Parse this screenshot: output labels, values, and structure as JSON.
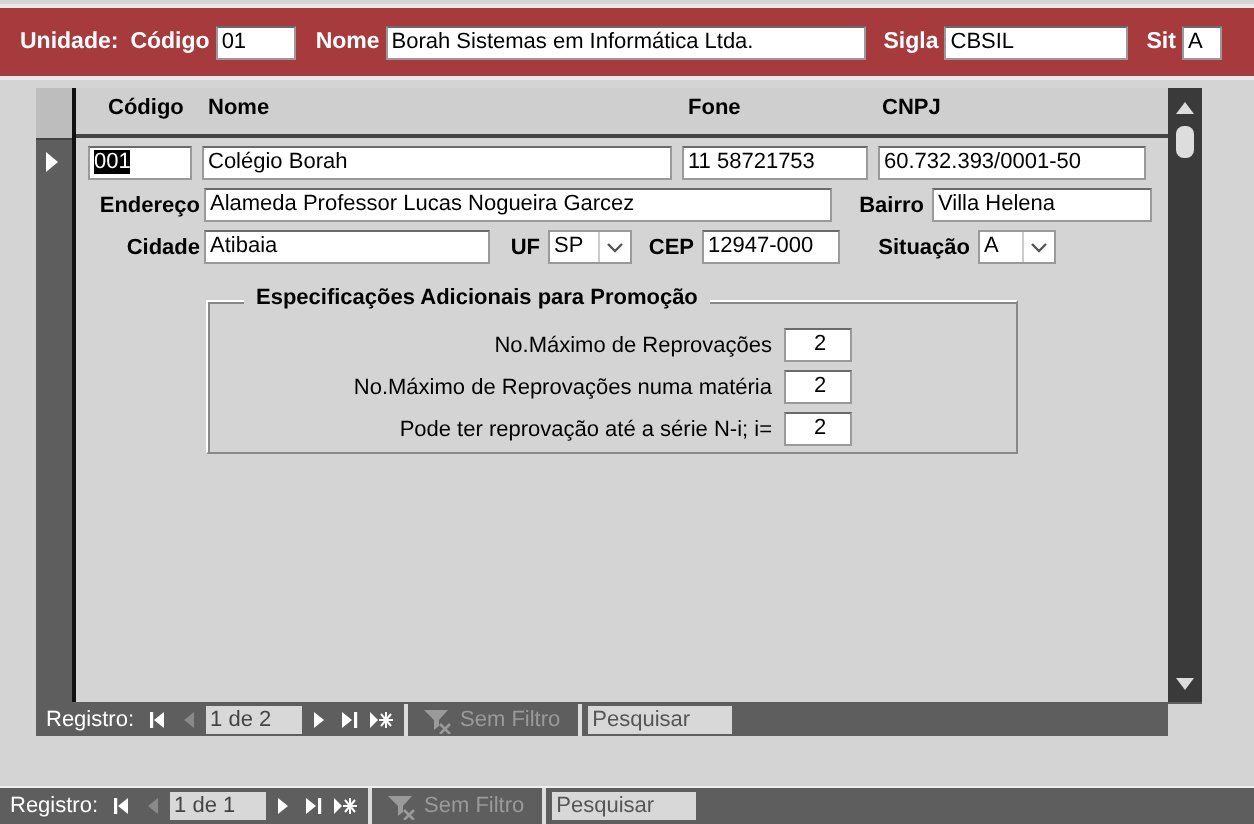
{
  "unit_bar": {
    "title": "Unidade:",
    "fields": [
      {
        "label": "Código",
        "value": "01"
      },
      {
        "label": "Nome",
        "value": "Borah Sistemas em Informática Ltda."
      },
      {
        "label": "Sigla",
        "value": "CBSIL"
      },
      {
        "label": "Sit",
        "value": "A"
      }
    ]
  },
  "subform": {
    "columns": [
      "Código",
      "Nome",
      "Fone",
      "CNPJ"
    ],
    "record": {
      "current": true,
      "codigo": {
        "value": "001",
        "text_selected": true
      },
      "nome": {
        "value": "Colégio Borah"
      },
      "fone": {
        "value": "11 58721753"
      },
      "cnpj": {
        "value": "60.732.393/0001-50"
      },
      "endereco": {
        "label": "Endereço",
        "value": "Alameda Professor Lucas Nogueira Garcez"
      },
      "bairro": {
        "label": "Bairro",
        "value": "Villa Helena"
      },
      "cidade": {
        "label": "Cidade",
        "value": "Atibaia"
      },
      "uf": {
        "label": "UF",
        "value": "SP"
      },
      "cep": {
        "label": "CEP",
        "value": "12947-000"
      },
      "situacao": {
        "label": "Situação",
        "value": "A"
      }
    },
    "group": {
      "title": "Especificações Adicionais para Promoção",
      "rows": [
        {
          "label": "No.Máximo de Reprovações",
          "value": "2"
        },
        {
          "label": "No.Máximo de Reprovações numa matéria",
          "value": "2"
        },
        {
          "label": "Pode ter reprovação até a série N-i; i=",
          "value": "2"
        }
      ]
    },
    "navigation": {
      "label": "Registro:",
      "position": "1 de 2",
      "buttons": [
        {
          "kind": "first",
          "disabled": false
        },
        {
          "kind": "previous",
          "disabled": true
        },
        {
          "kind": "next",
          "disabled": false
        },
        {
          "kind": "last",
          "disabled": false
        },
        {
          "kind": "new",
          "disabled": false
        }
      ],
      "filter": {
        "label": "Sem Filtro",
        "disabled": true
      },
      "search": {
        "placeholder": "Pesquisar"
      }
    }
  },
  "navigation": {
    "label": "Registro:",
    "position": "1 de 1",
    "buttons": [
      {
        "kind": "first",
        "disabled": false
      },
      {
        "kind": "previous",
        "disabled": true
      },
      {
        "kind": "next",
        "disabled": false
      },
      {
        "kind": "last",
        "disabled": false
      },
      {
        "kind": "new",
        "disabled": false
      }
    ],
    "filter": {
      "label": "Sem Filtro",
      "disabled": true
    },
    "search": {
      "placeholder": "Pesquisar"
    }
  }
}
